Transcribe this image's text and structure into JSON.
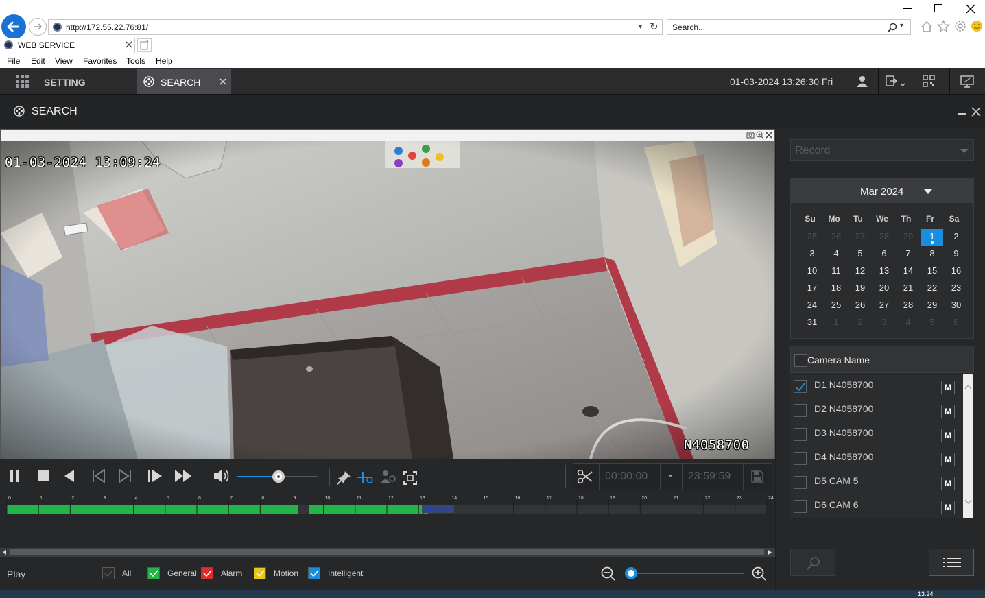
{
  "browser": {
    "address": "http://172.55.22.76:81/",
    "search_placeholder": "Search...",
    "tab_title": "WEB SERVICE",
    "menu": [
      "File",
      "Edit",
      "View",
      "Favorites",
      "Tools",
      "Help"
    ]
  },
  "app": {
    "setting_label": "SETTING",
    "search_tab_label": "SEARCH",
    "datetime": "01-03-2024 13:26:30 Fri",
    "page_title": "SEARCH"
  },
  "video": {
    "osd_timestamp": "01-03-2024 13:09:24",
    "osd_camera": "N4058700"
  },
  "playback": {
    "clip_start": "00:00:00",
    "clip_sep": "-",
    "clip_end": "23:59:59",
    "volume_fraction": 0.52,
    "zoom_fraction": 0.0
  },
  "timeline": {
    "hours": [
      "0",
      "1",
      "2",
      "3",
      "4",
      "5",
      "6",
      "7",
      "8",
      "9",
      "10",
      "11",
      "12",
      "13",
      "14",
      "15",
      "16",
      "17",
      "18",
      "19",
      "20",
      "21",
      "22",
      "23",
      "24"
    ],
    "cursor_time": "13:09:23",
    "recorded_ranges": [
      [
        0,
        9.2
      ],
      [
        9.55,
        13.3
      ]
    ]
  },
  "legend": {
    "play_label": "Play",
    "items": [
      {
        "label": "All",
        "color": "#2b2c2e",
        "checked": false
      },
      {
        "label": "General",
        "color": "#25b44a",
        "checked": true
      },
      {
        "label": "Alarm",
        "color": "#e02b2b",
        "checked": true
      },
      {
        "label": "Motion",
        "color": "#e6c619",
        "checked": true
      },
      {
        "label": "Intelligent",
        "color": "#1b8be0",
        "checked": true
      }
    ]
  },
  "panel": {
    "record_placeholder": "Record",
    "calendar": {
      "month_label": "Mar 2024",
      "dow": [
        "Su",
        "Mo",
        "Tu",
        "We",
        "Th",
        "Fr",
        "Sa"
      ],
      "weeks": [
        [
          [
            "25",
            true
          ],
          [
            "26",
            true
          ],
          [
            "27",
            true
          ],
          [
            "28",
            true
          ],
          [
            "29",
            true
          ],
          [
            "1",
            false,
            true
          ],
          [
            "2",
            false
          ]
        ],
        [
          [
            "3",
            false
          ],
          [
            "4",
            false
          ],
          [
            "5",
            false
          ],
          [
            "6",
            false
          ],
          [
            "7",
            false
          ],
          [
            "8",
            false
          ],
          [
            "9",
            false
          ]
        ],
        [
          [
            "10",
            false
          ],
          [
            "11",
            false
          ],
          [
            "12",
            false
          ],
          [
            "13",
            false
          ],
          [
            "14",
            false
          ],
          [
            "15",
            false
          ],
          [
            "16",
            false
          ]
        ],
        [
          [
            "17",
            false
          ],
          [
            "18",
            false
          ],
          [
            "19",
            false
          ],
          [
            "20",
            false
          ],
          [
            "21",
            false
          ],
          [
            "22",
            false
          ],
          [
            "23",
            false
          ]
        ],
        [
          [
            "24",
            false
          ],
          [
            "25",
            false
          ],
          [
            "26",
            false
          ],
          [
            "27",
            false
          ],
          [
            "28",
            false
          ],
          [
            "29",
            false
          ],
          [
            "30",
            false
          ]
        ],
        [
          [
            "31",
            false
          ],
          [
            "1",
            true
          ],
          [
            "2",
            true
          ],
          [
            "3",
            true
          ],
          [
            "4",
            true
          ],
          [
            "5",
            true
          ],
          [
            "6",
            true
          ]
        ]
      ]
    },
    "camera_header": "Camera Name",
    "cameras": [
      {
        "label": "D1 N4058700",
        "checked": true,
        "mode": "M"
      },
      {
        "label": "D2 N4058700",
        "checked": false,
        "mode": "M"
      },
      {
        "label": "D3 N4058700",
        "checked": false,
        "mode": "M"
      },
      {
        "label": "D4 N4058700",
        "checked": false,
        "mode": "M"
      },
      {
        "label": "D5 CAM 5",
        "checked": false,
        "mode": "M"
      },
      {
        "label": "D6 CAM 6",
        "checked": false,
        "mode": "M"
      }
    ]
  },
  "taskbar": {
    "clock": "13:24"
  }
}
